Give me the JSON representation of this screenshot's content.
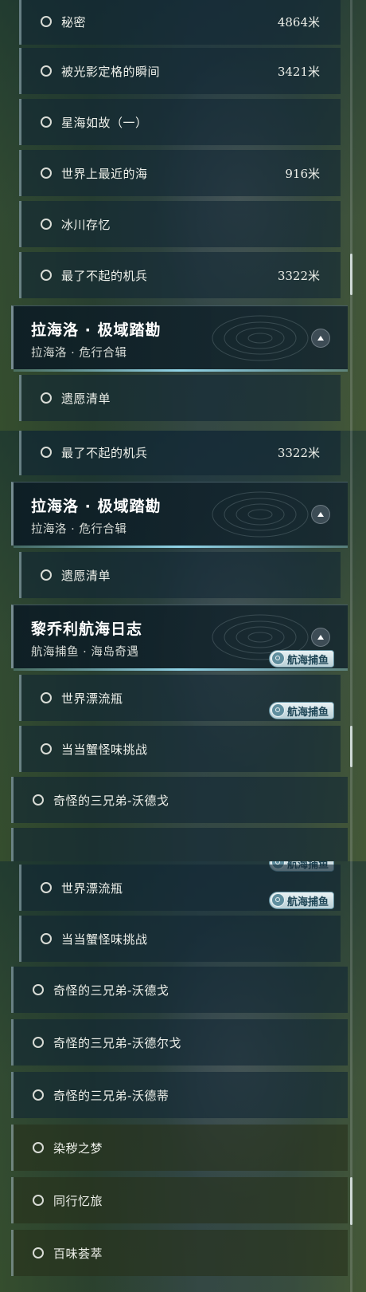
{
  "panel1": {
    "items": [
      {
        "label": "秘密",
        "distance": "4864米"
      },
      {
        "label": "被光影定格的瞬间",
        "distance": "3421米"
      },
      {
        "label": "星海如故（一）",
        "distance": ""
      },
      {
        "label": "世界上最近的海",
        "distance": "916米"
      },
      {
        "label": "冰川存忆",
        "distance": ""
      },
      {
        "label": "最了不起的机兵",
        "distance": "3322米"
      }
    ],
    "group": {
      "title": "拉海洛 · 极域踏勘",
      "subtitle": "拉海洛 · 危行合辑"
    },
    "after_items": [
      {
        "label": "遗愿清单",
        "distance": ""
      }
    ]
  },
  "panel2": {
    "items": [
      {
        "label": "最了不起的机兵",
        "distance": "3322米"
      }
    ],
    "group1": {
      "title": "拉海洛 · 极域踏勘",
      "subtitle": "拉海洛 · 危行合辑"
    },
    "group1_items": [
      {
        "label": "遗愿清单",
        "distance": ""
      }
    ],
    "group2": {
      "title": "黎乔利航海日志",
      "subtitle": "航海捕鱼 · 海岛奇遇"
    },
    "group2_items": [
      {
        "label": "世界漂流瓶",
        "tag": "航海捕鱼"
      },
      {
        "label": "当当蟹怪味挑战",
        "tag": "航海捕鱼"
      },
      {
        "label": "奇怪的三兄弟-沃德戈"
      }
    ]
  },
  "panel3": {
    "tag_cut": "航海捕鱼",
    "items": [
      {
        "label": "世界漂流瓶"
      },
      {
        "label": "当当蟹怪味挑战",
        "tag": "航海捕鱼"
      },
      {
        "label": "奇怪的三兄弟-沃德戈"
      },
      {
        "label": "奇怪的三兄弟-沃德尔戈"
      },
      {
        "label": "奇怪的三兄弟-沃德蒂"
      },
      {
        "label": "染秽之梦"
      },
      {
        "label": "同行忆旅"
      },
      {
        "label": "百味荟萃"
      }
    ]
  },
  "colors": {
    "accent": "#96dcf0",
    "tag_text": "#1f4656",
    "text": "#eef0ea"
  },
  "icons": {
    "radio": "radio-circle-icon",
    "collapse": "chevron-up-icon",
    "tag": "fish-badge-icon"
  }
}
